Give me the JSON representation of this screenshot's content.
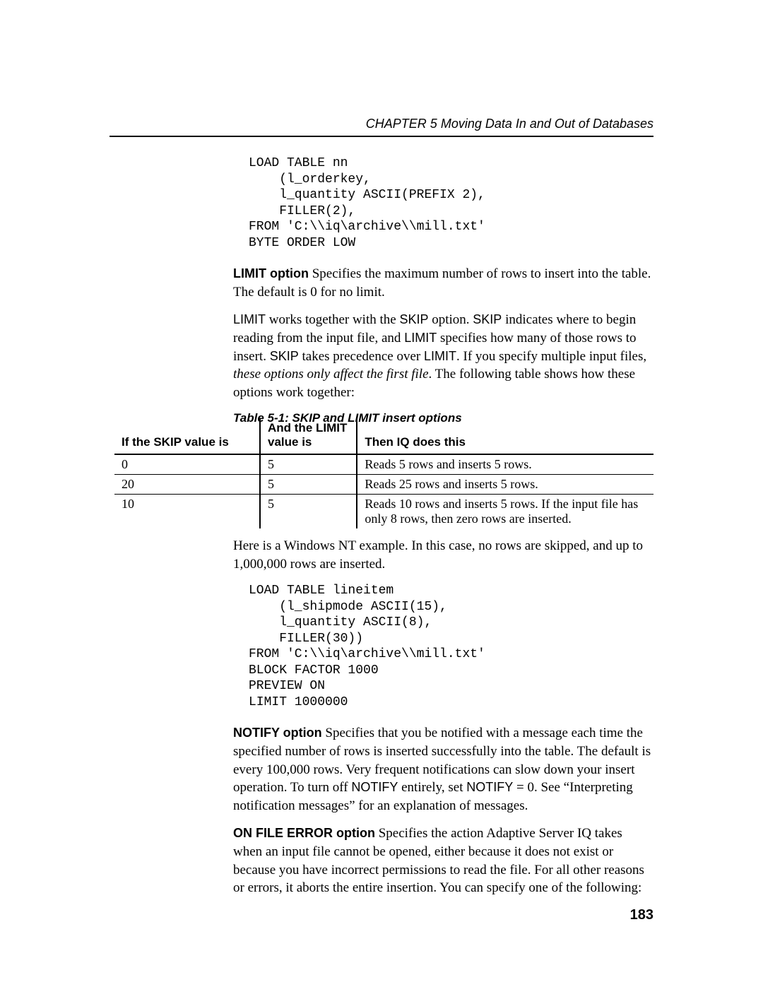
{
  "header": {
    "chapter": "CHAPTER 5    Moving Data In and Out of Databases"
  },
  "code1": "LOAD TABLE nn\n    (l_orderkey,\n    l_quantity ASCII(PREFIX 2),\n    FILLER(2),\nFROM 'C:\\\\iq\\archive\\\\mill.txt'\nBYTE ORDER LOW",
  "p1": {
    "strong": "LIMIT option",
    "rest": "      Specifies the maximum number of rows to insert into the table. The default is 0 for no limit."
  },
  "p2": {
    "a": "LIMIT",
    "b": " works together with the ",
    "c": "SKIP",
    "d": " option. ",
    "e": "SKIP",
    "f": " indicates where to begin reading from the input file, and ",
    "g": "LIMIT",
    "h": " specifies how many of those rows to insert. ",
    "i": "SKIP",
    "j": " takes precedence over ",
    "k": "LIMIT",
    "l": ". If you specify multiple input files, ",
    "m": "these options only affect the first file",
    "n": ". The following table shows how these options work together:"
  },
  "tableCaption": "Table 5-1: SKIP and LIMIT insert options",
  "tableHeaders": {
    "c1": "If the SKIP value is",
    "c2a": "And the LIMIT",
    "c2b": "value is",
    "c3": "Then IQ does this"
  },
  "tableRows": [
    {
      "skip": "0",
      "limit": "5",
      "result": "Reads 5 rows and inserts 5 rows."
    },
    {
      "skip": "20",
      "limit": "5",
      "result": "Reads 25 rows and inserts 5 rows."
    },
    {
      "skip": "10",
      "limit": "5",
      "result": "Reads 10 rows and inserts 5 rows. If the input file has only 8 rows, then zero rows are inserted."
    }
  ],
  "p3": "Here is a Windows NT example. In this case, no rows are skipped, and up to 1,000,000 rows are inserted.",
  "code2": "LOAD TABLE lineitem\n    (l_shipmode ASCII(15),\n    l_quantity ASCII(8),\n    FILLER(30))\nFROM 'C:\\\\iq\\archive\\\\mill.txt'\nBLOCK FACTOR 1000\nPREVIEW ON\nLIMIT 1000000",
  "p4": {
    "strong": "NOTIFY option",
    "a": "      Specifies that you be notified with a message each time the specified number of rows is inserted successfully into the table. The default is every 100,000 rows. Very frequent notifications can slow down your insert operation. To turn off ",
    "b": "NOTIFY",
    "c": " entirely, set ",
    "d": "NOTIFY",
    "e": " = 0. See “Interpreting notification messages” for an explanation of messages."
  },
  "p5": {
    "strong": "ON FILE ERROR option",
    "rest": "      Specifies the action Adaptive Server IQ takes when an input file cannot be opened, either because it does not exist or because you have incorrect permissions to read the file. For all other reasons or errors, it aborts the entire insertion. You can specify one of the following:"
  },
  "pageNumber": "183"
}
